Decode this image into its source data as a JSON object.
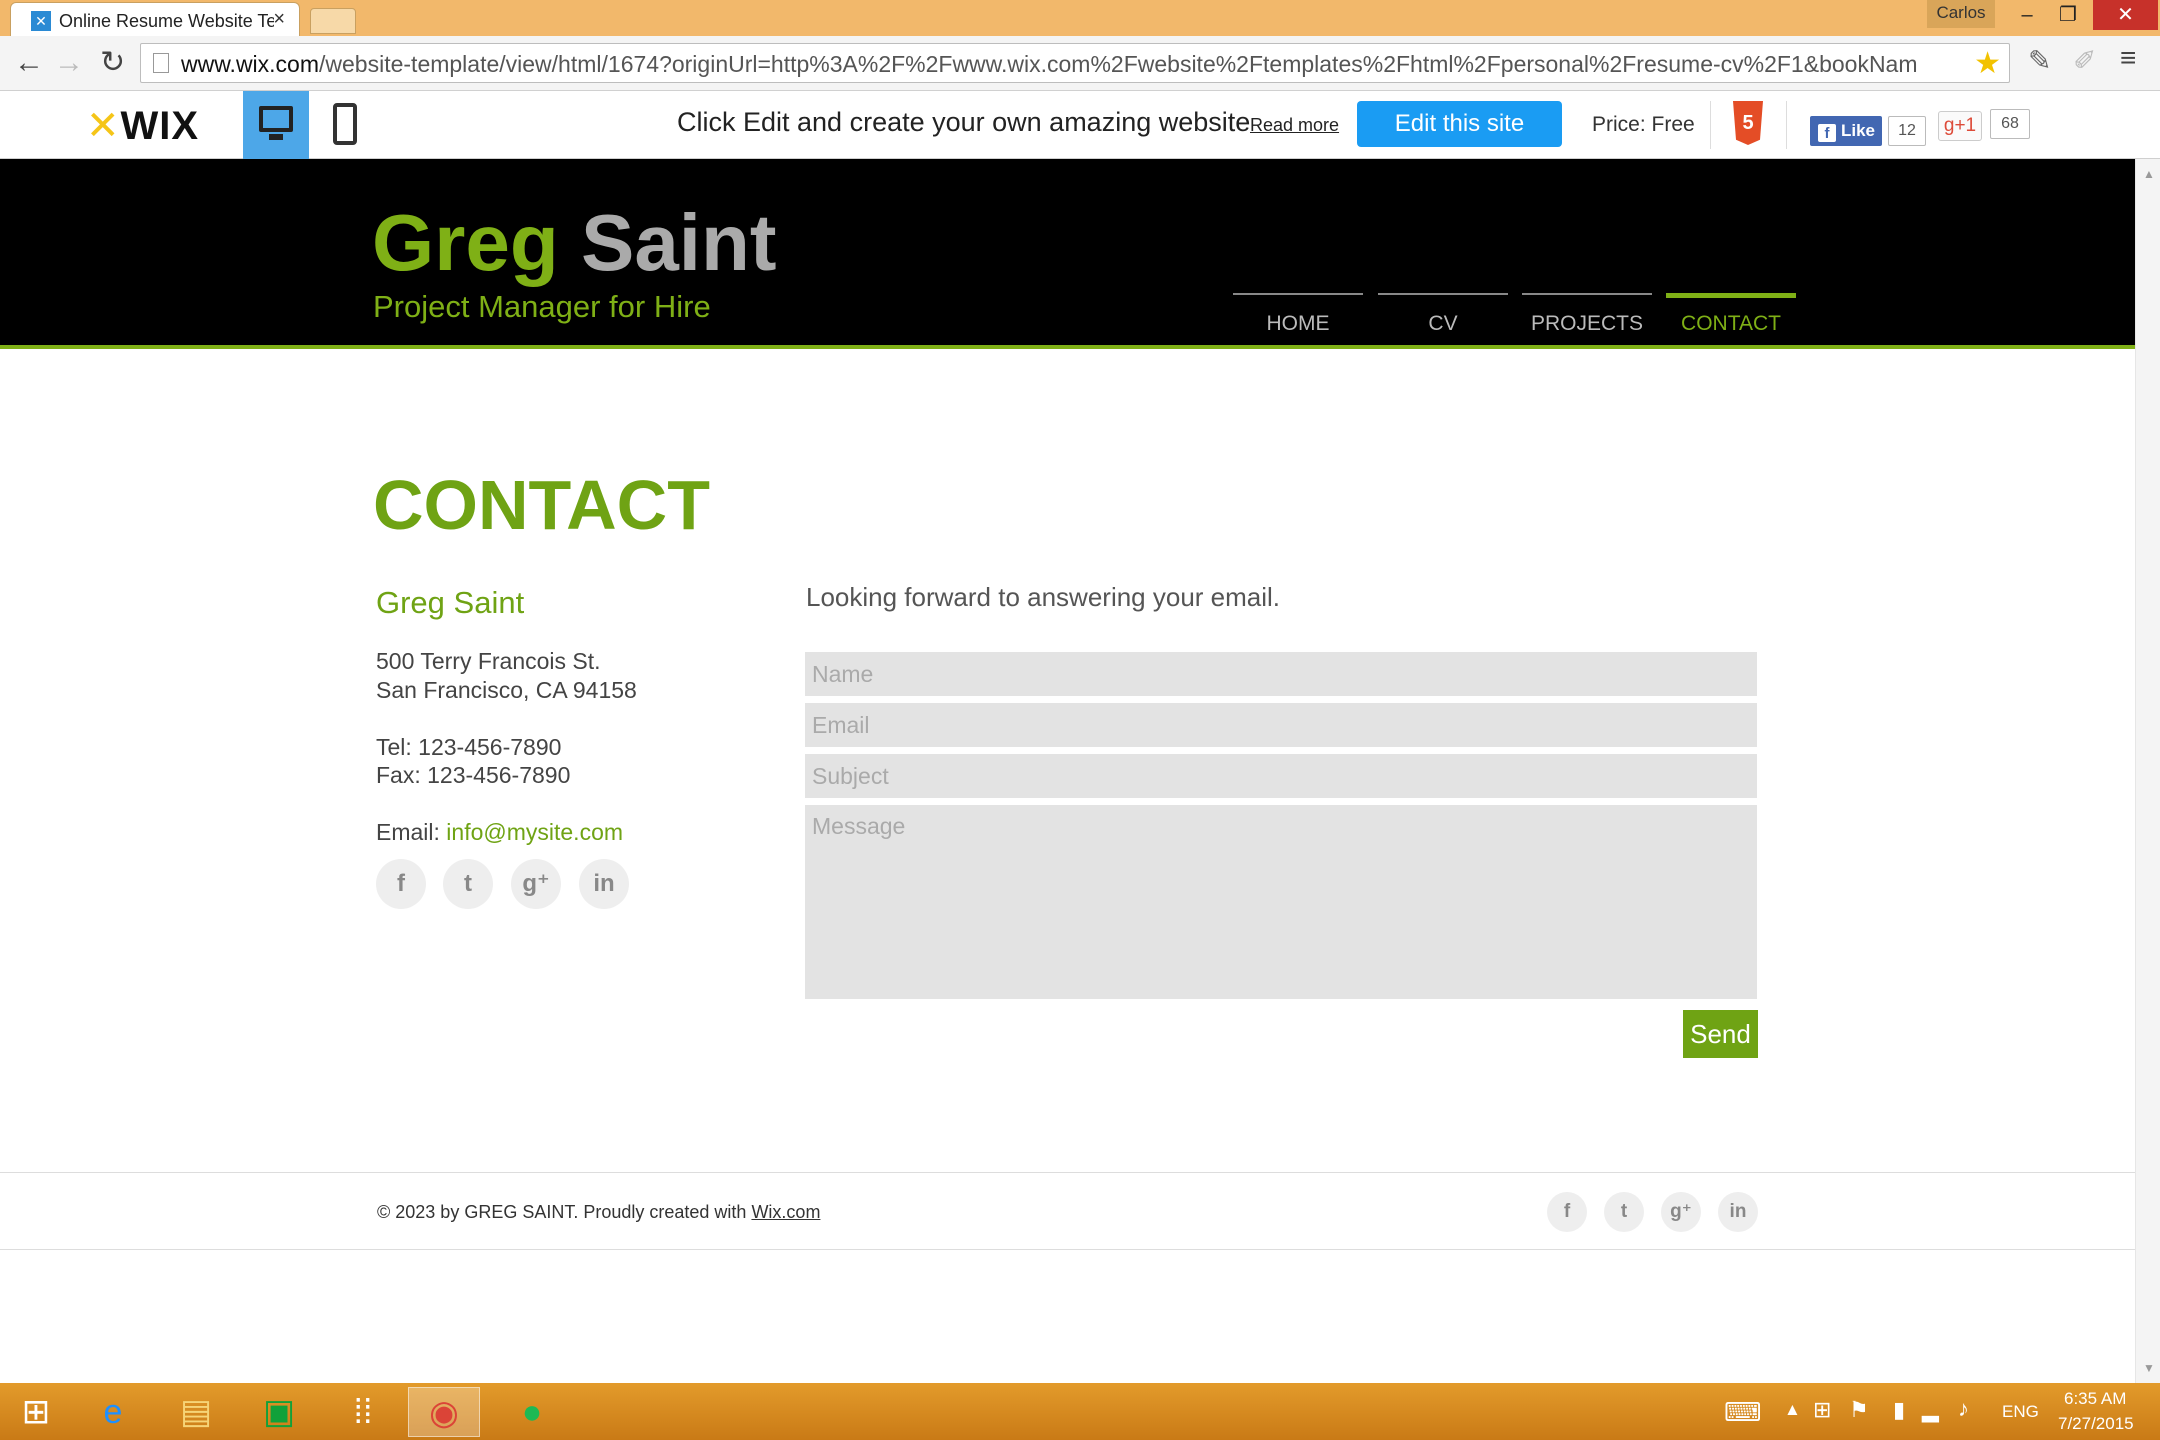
{
  "browser": {
    "tab_title": "Online Resume Website Te",
    "user_name": "Carlos",
    "url_host": "www.wix.com",
    "url_path": "/website-template/view/html/1674?originUrl=http%3A%2F%2Fwww.wix.com%2Fwebsite%2Ftemplates%2Fhtml%2Fpersonal%2Fresume-cv%2F1&bookNam"
  },
  "wixbar": {
    "logo": "WIX",
    "promo_text": "Click Edit and create your own amazing website",
    "read_more": "Read more",
    "edit_button": "Edit this site",
    "price": "Price: Free",
    "html5_badge": "5",
    "fb_like": "Like",
    "fb_count": "12",
    "gplus_label": "g+1",
    "gplus_count": "68"
  },
  "site": {
    "first_name": "Greg",
    "last_name": "Saint",
    "tagline": "Project Manager for Hire",
    "nav": [
      "HOME",
      "CV",
      "PROJECTS",
      "CONTACT"
    ],
    "active_nav": "CONTACT"
  },
  "contact": {
    "heading": "CONTACT",
    "name": "Greg Saint",
    "address_line1": "500 Terry Francois St.",
    "address_line2": "San Francisco, CA 94158",
    "tel": "Tel: 123-456-7890",
    "fax": "Fax: 123-456-7890",
    "email_label": "Email: ",
    "email": "info@mysite.com",
    "intro": "Looking forward to answering your email.",
    "form": {
      "name_placeholder": "Name",
      "email_placeholder": "Email",
      "subject_placeholder": "Subject",
      "message_placeholder": "Message",
      "send_label": "Send"
    },
    "social_icons": [
      "facebook-icon",
      "twitter-icon",
      "google-plus-icon",
      "linkedin-icon"
    ]
  },
  "footer": {
    "copyright": "© 2023 by GREG SAINT. Proudly created with ",
    "link": "Wix.com"
  },
  "taskbar": {
    "language": "ENG",
    "time": "6:35 AM",
    "date": "7/27/2015"
  },
  "colors": {
    "accent_green": "#6fa314",
    "header_bg": "#000000",
    "edit_button_blue": "#1a9cf3",
    "titlebar_orange": "#f2b86b"
  }
}
